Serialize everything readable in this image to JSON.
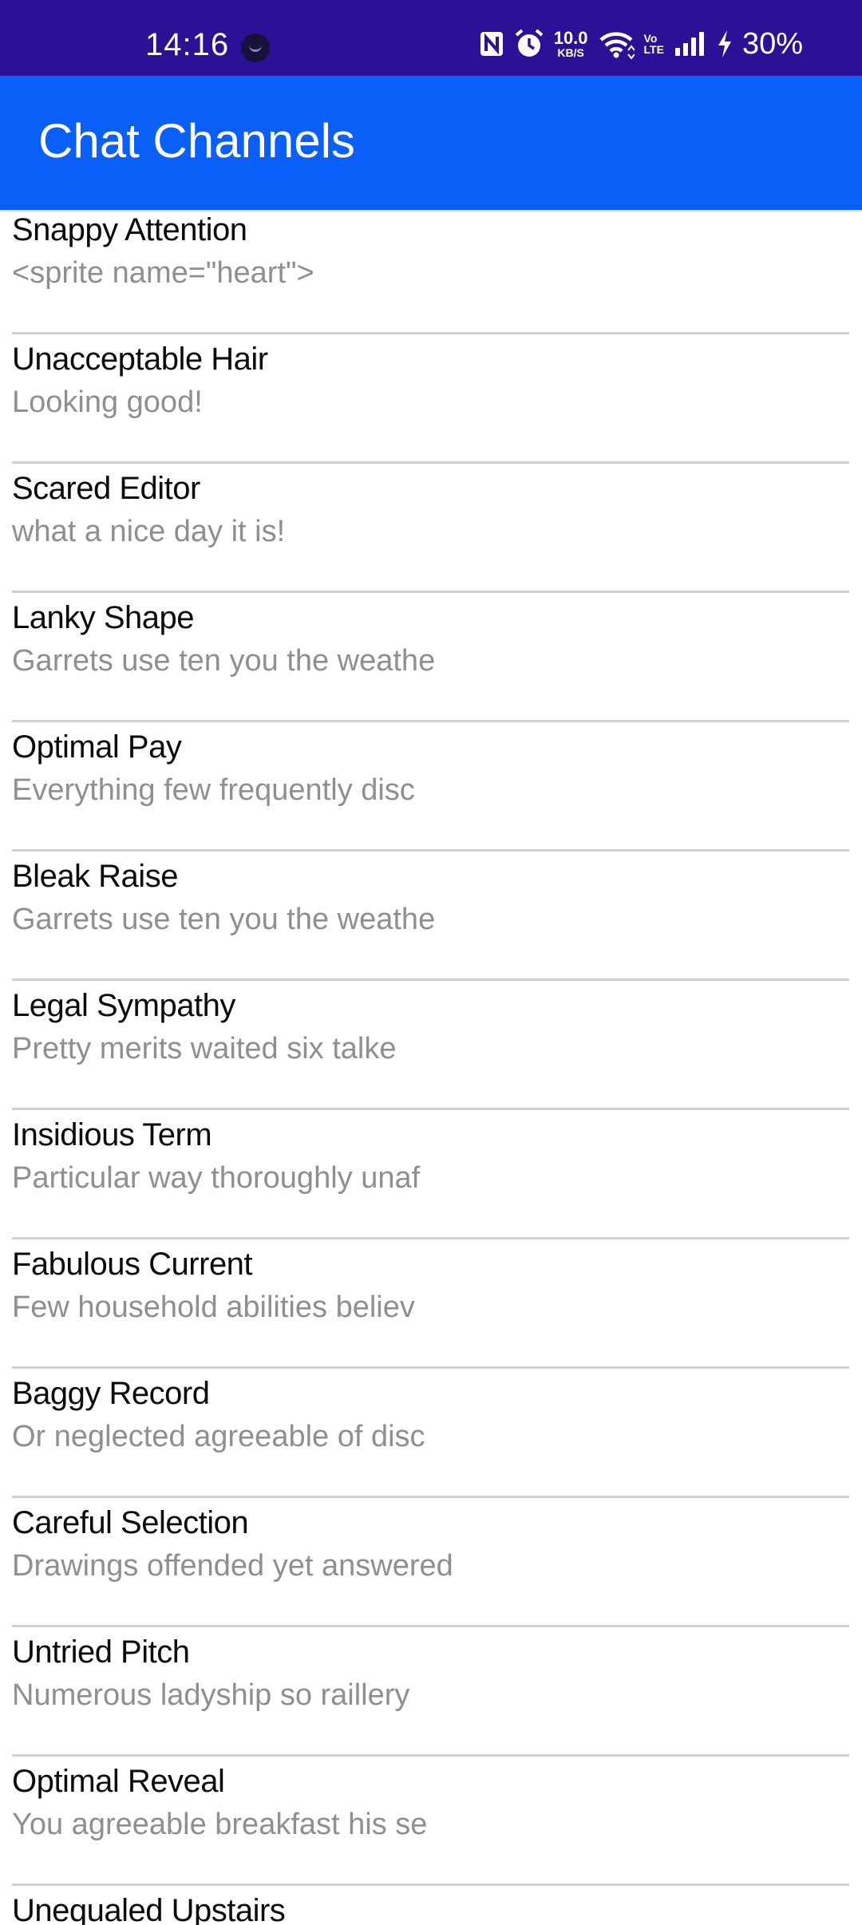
{
  "status_bar": {
    "time": "14:16",
    "speed_value": "10.0",
    "speed_unit": "KB/S",
    "volte_top": "Vo",
    "volte_bottom": "LTE",
    "battery": "30%",
    "background": "#2b1196"
  },
  "app_bar": {
    "title": "Chat Channels",
    "background": "#0a5ff8"
  },
  "channels": [
    {
      "name": "Snappy Attention",
      "message": "<sprite name=\"heart\">"
    },
    {
      "name": "Unacceptable Hair",
      "message": "Looking good!"
    },
    {
      "name": "Scared Editor",
      "message": "what a nice day it is!"
    },
    {
      "name": "Lanky Shape",
      "message": "Garrets use ten you the weathe"
    },
    {
      "name": "Optimal Pay",
      "message": "Everything few frequently disc"
    },
    {
      "name": "Bleak Raise",
      "message": "Garrets use ten you the weathe"
    },
    {
      "name": "Legal Sympathy",
      "message": "Pretty merits waited six talke"
    },
    {
      "name": "Insidious Term",
      "message": "Particular way thoroughly unaf"
    },
    {
      "name": "Fabulous Current",
      "message": "Few household abilities believ"
    },
    {
      "name": "Baggy Record",
      "message": "Or neglected agreeable of disc"
    },
    {
      "name": "Careful Selection",
      "message": "Drawings offended yet answered"
    },
    {
      "name": "Untried Pitch",
      "message": "Numerous ladyship so raillery"
    },
    {
      "name": "Optimal Reveal",
      "message": "You agreeable breakfast his se"
    },
    {
      "name": "Unequaled Upstairs",
      "message": ""
    }
  ]
}
